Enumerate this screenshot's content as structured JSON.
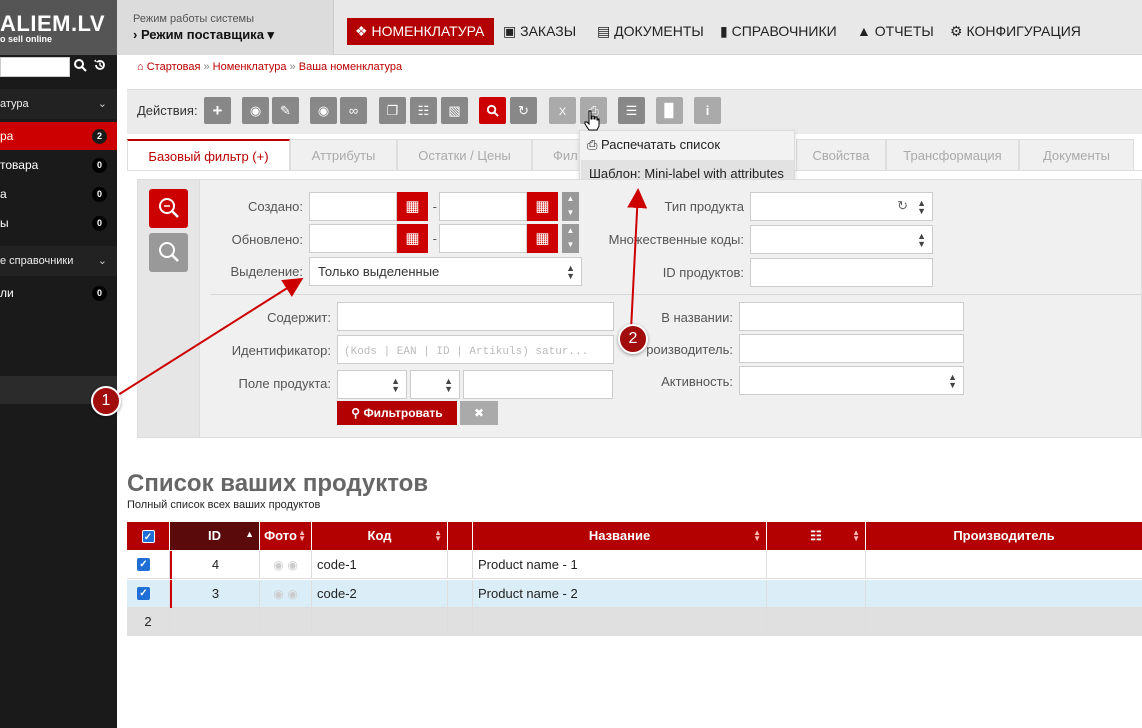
{
  "sidebar": {
    "logo": "ALIEM.LV",
    "logo_sub": "o sell online",
    "groups": [
      {
        "label": "атура"
      },
      {
        "label": "е справочники"
      }
    ],
    "items": [
      {
        "label": "ра",
        "count": "2"
      },
      {
        "label": "товара",
        "count": "0"
      },
      {
        "label": "а",
        "count": "0"
      },
      {
        "label": "ы",
        "count": "0"
      },
      {
        "label": "ли",
        "count": "0"
      }
    ]
  },
  "header": {
    "mode_label": "Режим работы системы",
    "mode_value": "› Режим поставщика ▾",
    "nav": [
      {
        "label": "НОМЕНКЛАТУРА",
        "icon": "cubes-icon"
      },
      {
        "label": "ЗАКАЗЫ",
        "icon": "basket-icon"
      },
      {
        "label": "ДОКУМЕНТЫ",
        "icon": "document-icon"
      },
      {
        "label": "СПРАВОЧНИКИ",
        "icon": "book-icon"
      },
      {
        "label": "ОТЧЕТЫ",
        "icon": "chart-icon"
      },
      {
        "label": "КОНФИГУРАЦИЯ",
        "icon": "gears-icon"
      }
    ]
  },
  "breadcrumb": {
    "home": "Стартовая",
    "level1": "Номенклатура",
    "level2": "Ваша номенклатура",
    "sep": "»"
  },
  "toolbar": {
    "label": "Действия:"
  },
  "dropdown": {
    "print_list": "Распечатать список",
    "template": "Шаблон: Mini-label with attributes"
  },
  "tabs": [
    {
      "label": "Базовый фильтр (+)"
    },
    {
      "label": "Аттрибуты"
    },
    {
      "label": "Остатки / Цены"
    },
    {
      "label": "Фил"
    },
    {
      "label": "Свойства"
    },
    {
      "label": "Трансформация"
    },
    {
      "label": "Документы"
    }
  ],
  "filter": {
    "created_label": "Создано:",
    "updated_label": "Обновлено:",
    "selection_label": "Выделение:",
    "selection_value": "Только выделенные",
    "product_type_label": "Тип продукта",
    "multi_codes_label": "Множественные коды:",
    "product_ids_label": "ID продуктов:",
    "contains_label": "Содержит:",
    "identifier_label": "Идентификатор:",
    "identifier_placeholder": "(Kods | EAN | ID | Artikuls) satur...",
    "product_field_label": "Поле продукта:",
    "in_name_label": "В названии:",
    "manufacturer_label": "роизводитель:",
    "activity_label": "Активность:",
    "date_sep": "-",
    "filter_button": "Фильтровать",
    "clear_button": "✖"
  },
  "list": {
    "title": "Список ваших продуктов",
    "subtitle": "Полный список всех ваших продуктов",
    "columns": [
      "ID",
      "Фото",
      "Код",
      "Название",
      "Производитель"
    ],
    "rows": [
      {
        "id": "4",
        "code": "code-1",
        "name": "Product name - 1"
      },
      {
        "id": "3",
        "code": "code-2",
        "name": "Product name - 2"
      }
    ],
    "total": "2"
  },
  "annotations": {
    "marker1": "1",
    "marker2": "2"
  },
  "colors": {
    "brand_red": "#b30000",
    "sidebar_bg": "#1a1a1a",
    "selected_row": "#dbeef8"
  }
}
